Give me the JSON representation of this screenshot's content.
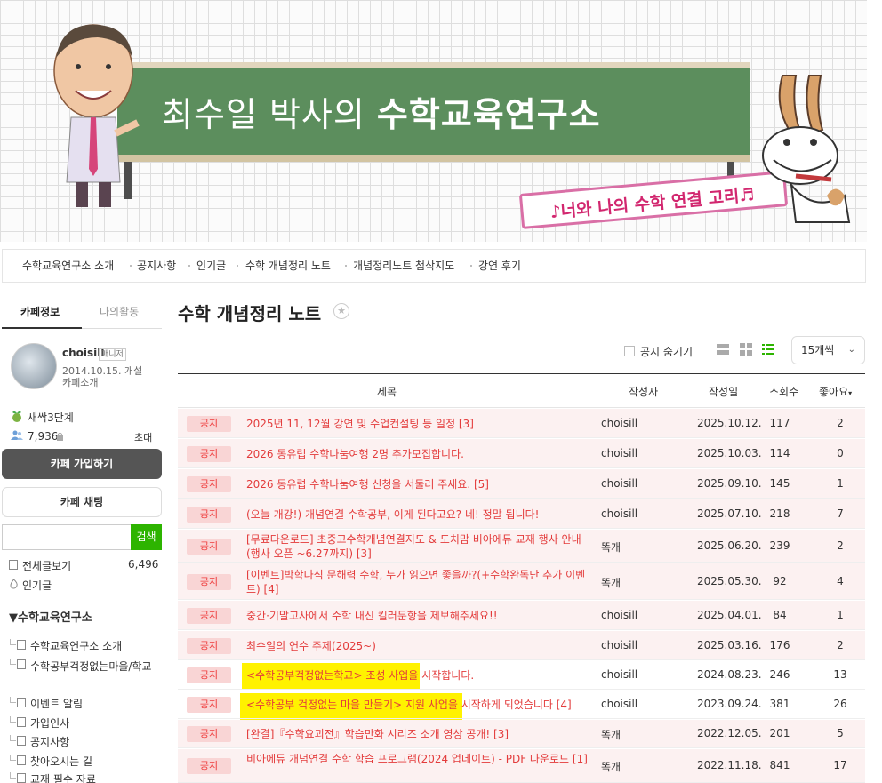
{
  "banner": {
    "title_normal": "최수일 박사의 ",
    "title_bold": "수학교육연구소",
    "slogan": "♪너와 나의 수학 연결 고리♬"
  },
  "nav": {
    "items": [
      "수학교육연구소 소개",
      "공지사항",
      "인기글",
      "수학 개념정리 노트",
      "개념정리노트 첨삭지도",
      "강연 후기"
    ],
    "active_index": 3
  },
  "sidebar": {
    "tabs": [
      "카페정보",
      "나의활동"
    ],
    "profile": {
      "nickname": "choisill",
      "role": "매니저",
      "date": "2014.10.15. 개설",
      "cafe_intro": "카페소개"
    },
    "level": "새싹3단계",
    "members": "7,936",
    "invite": "초대",
    "join_button": "카페 가입하기",
    "chat_button": "카페 채팅",
    "search_button": "검색",
    "all_posts": "전체글보기",
    "all_posts_count": "6,496",
    "popular": "인기글",
    "group_title": "▼수학교육연구소",
    "menu": [
      "수학교육연구소 소개",
      "수학공부걱정없는마을/학교",
      "이벤트 알림",
      "가입인사",
      "공지사항",
      "찾아오시는 길",
      "교재 필수 자료"
    ]
  },
  "main": {
    "page_title": "수학 개념정리 노트",
    "hide_notice": "공지 숨기기",
    "per_page": "15개씩",
    "headers": {
      "title": "제목",
      "author": "작성자",
      "date": "작성일",
      "views": "조회수",
      "likes": "좋아요"
    },
    "badge_label": "공지",
    "rows": [
      {
        "title": "2025년 11, 12월 강연 및 수업컨설팅 등 일정 [3]",
        "author": "choisill",
        "date": "2025.10.12.",
        "views": "117",
        "likes": "2"
      },
      {
        "title": "2026 동유럽 수학나눔여행 2명 추가모집합니다.",
        "author": "choisill",
        "date": "2025.10.03.",
        "views": "114",
        "likes": "0"
      },
      {
        "title": "2026 동유럽 수학나눔여행 신청을 서둘러 주세요. [5]",
        "author": "choisill",
        "date": "2025.09.10.",
        "views": "145",
        "likes": "1"
      },
      {
        "title": "(오늘 개강!) 개념연결 수학공부, 이게 된다고요? 네! 정말 됩니다!",
        "author": "choisill",
        "date": "2025.07.10.",
        "views": "218",
        "likes": "7"
      },
      {
        "title": "[무료다운로드] 초중고수학개념연결지도 & 도치맘 비아에듀 교재 행사 안내(행사 오픈 ~6.27까지) [3]",
        "author": "똑개",
        "date": "2025.06.20.",
        "views": "239",
        "likes": "2"
      },
      {
        "title": "[이벤트]박학다식 문해력 수학, 누가 읽으면 좋을까?(+수학완독단 추가 이벤트) [4]",
        "author": "똑개",
        "date": "2025.05.30.",
        "views": "92",
        "likes": "4"
      },
      {
        "title": "중간·기말고사에서 수학 내신 킬러문항을 제보해주세요!!",
        "author": "choisill",
        "date": "2025.04.01.",
        "views": "84",
        "likes": "1"
      },
      {
        "title": "최수일의 연수 주제(2025~)",
        "author": "choisill",
        "date": "2025.03.16.",
        "views": "176",
        "likes": "2"
      },
      {
        "title": "<수학공부걱정없는학교> 조성 사업을 시작합니다.",
        "author": "choisill",
        "date": "2024.08.23.",
        "views": "246",
        "likes": "13"
      },
      {
        "title": "<수학공부 걱정없는 마을 만들기> 지원 사업을 시작하게 되었습니다 [4]",
        "author": "choisill",
        "date": "2023.09.24.",
        "views": "381",
        "likes": "26"
      },
      {
        "title": "[완결]『수학요괴전』학습만화 시리즈 소개 영상 공개! [3]",
        "author": "똑개",
        "date": "2022.12.05.",
        "views": "201",
        "likes": "5"
      },
      {
        "title": "비아에듀 개념연결 수학 학습 프로그램(2024 업데이트) - PDF 다운로드 [1]",
        "author": "똑개",
        "date": "2022.11.18.",
        "views": "841",
        "likes": "17"
      }
    ]
  },
  "colors": {
    "notice_text": "#e33b3b",
    "notice_badge_bg": "#f9d5d5",
    "row_bg": "#fcf1f1",
    "highlight": "#fff200",
    "search_green": "#2db400",
    "board_green": "#5c8e5d"
  }
}
